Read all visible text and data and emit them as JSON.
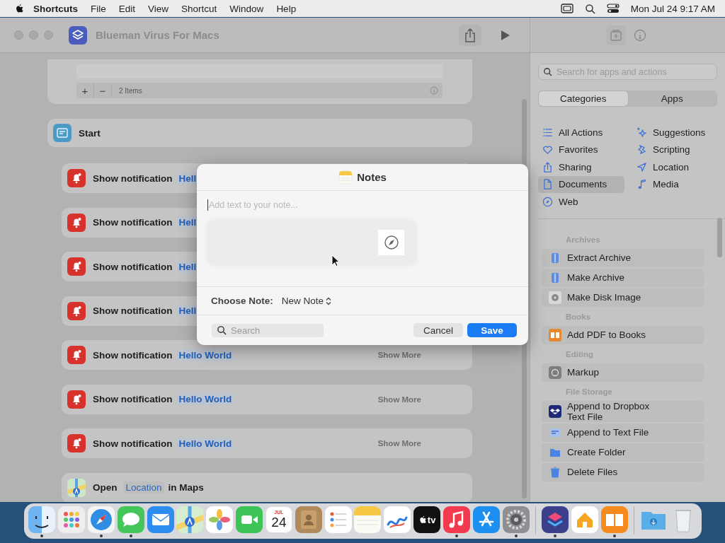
{
  "menu_bar": {
    "app_name": "Shortcuts",
    "menus": [
      "File",
      "Edit",
      "View",
      "Shortcut",
      "Window",
      "Help"
    ],
    "clock": "Mon Jul 24  9:17 AM"
  },
  "window": {
    "title": "Blueman Virus For Macs"
  },
  "editor": {
    "list_card": {
      "add": "+",
      "remove": "−",
      "count": "2 Items"
    },
    "start": {
      "label": "Start"
    },
    "actions": [
      {
        "kind": "notification",
        "label": "Show notification",
        "value": "Hell"
      },
      {
        "kind": "notification",
        "label": "Show notification",
        "value": "Hell"
      },
      {
        "kind": "notification",
        "label": "Show notification",
        "value": "Hell"
      },
      {
        "kind": "notification",
        "label": "Show notification",
        "value": "Hell"
      },
      {
        "kind": "notification",
        "label": "Show notification",
        "value": "Hello World",
        "more": "Show More"
      },
      {
        "kind": "notification",
        "label": "Show notification",
        "value": "Hello World",
        "more": "Show More"
      },
      {
        "kind": "notification",
        "label": "Show notification",
        "value": "Hello World",
        "more": "Show More"
      },
      {
        "kind": "maps",
        "label": "Open",
        "value": "Location",
        "suffix": "in Maps"
      }
    ]
  },
  "dialog": {
    "title": "Notes",
    "placeholder": "Add text to your note...",
    "choose_label": "Choose Note:",
    "choose_value": "New Note",
    "search_placeholder": "Search",
    "cancel": "Cancel",
    "save": "Save"
  },
  "sidebar": {
    "search": {
      "placeholder": "Search for apps and actions"
    },
    "segments": [
      {
        "label": "Categories",
        "selected": true
      },
      {
        "label": "Apps",
        "selected": false
      }
    ],
    "categories": [
      {
        "kind": "list",
        "label": "All Actions",
        "selected": false
      },
      {
        "kind": "sparkle",
        "label": "Suggestions",
        "selected": false
      },
      {
        "kind": "heart",
        "label": "Favorites",
        "selected": false
      },
      {
        "kind": "scripting",
        "label": "Scripting",
        "selected": false
      },
      {
        "kind": "share",
        "label": "Sharing",
        "selected": false
      },
      {
        "kind": "location",
        "label": "Location",
        "selected": false
      },
      {
        "kind": "document",
        "label": "Documents",
        "selected": true
      },
      {
        "kind": "music",
        "label": "Media",
        "selected": false
      },
      {
        "kind": "compass",
        "label": "Web",
        "selected": false
      }
    ],
    "sections": [
      {
        "title": "Archives",
        "items": [
          {
            "kind": "archive",
            "label": "Extract Archive"
          },
          {
            "kind": "archive",
            "label": "Make Archive"
          },
          {
            "kind": "disk",
            "label": "Make Disk Image"
          }
        ]
      },
      {
        "title": "Books",
        "items": [
          {
            "kind": "books",
            "label": "Add PDF to Books"
          }
        ]
      },
      {
        "title": "Editing",
        "items": [
          {
            "kind": "markup",
            "label": "Markup"
          }
        ]
      },
      {
        "title": "File Storage",
        "items": [
          {
            "kind": "dropbox",
            "label": "Append to Dropbox Text File"
          },
          {
            "kind": "textfile",
            "label": "Append to Text File"
          },
          {
            "kind": "folder",
            "label": "Create Folder"
          },
          {
            "kind": "trash",
            "label": "Delete Files"
          }
        ]
      }
    ]
  },
  "dock": {
    "items": [
      {
        "kind": "finder",
        "running": true
      },
      {
        "kind": "launchpad",
        "running": false
      },
      {
        "kind": "safari",
        "running": true
      },
      {
        "kind": "messages",
        "running": true
      },
      {
        "kind": "mail",
        "running": false
      },
      {
        "kind": "maps",
        "running": false
      },
      {
        "kind": "photos",
        "running": false
      },
      {
        "kind": "facetime",
        "running": false
      },
      {
        "kind": "calendar",
        "month": "JUL",
        "day": "24",
        "running": false
      },
      {
        "kind": "contacts",
        "running": false
      },
      {
        "kind": "reminders",
        "running": false
      },
      {
        "kind": "notes",
        "running": false
      },
      {
        "kind": "freeform",
        "running": false
      },
      {
        "kind": "tv",
        "label": "tv",
        "running": false
      },
      {
        "kind": "music",
        "running": true
      },
      {
        "kind": "appstore",
        "running": false
      },
      {
        "kind": "settings",
        "running": true
      },
      {
        "kind": "divider"
      },
      {
        "kind": "shortcuts",
        "running": true
      },
      {
        "kind": "home",
        "running": false
      },
      {
        "kind": "books",
        "running": true
      },
      {
        "kind": "divider"
      },
      {
        "kind": "downloads",
        "running": false
      },
      {
        "kind": "trash",
        "running": false
      }
    ]
  }
}
